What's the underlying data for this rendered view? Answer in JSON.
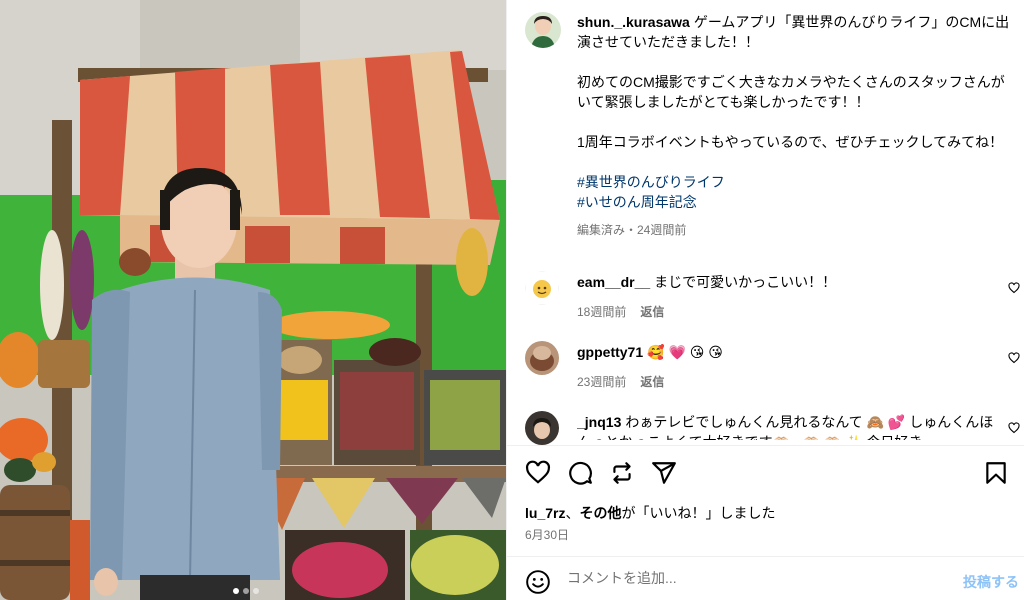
{
  "post": {
    "username": "shun._.kurasawa",
    "caption_lines": [
      "ゲームアプリ「異世界のんびりライフ」のCMに出演させていただきました！！",
      "初めてのCM撮影ですごく大きなカメラやたくさんのスタッフさんがいて緊張しましたがとても楽しかったです！！",
      "1周年コラボイベントもやっているので、ぜひチェックしてみてね！"
    ],
    "hashtags": [
      "#異世界のんびりライフ",
      "#いせのん周年記念"
    ],
    "meta": "編集済み・24週間前"
  },
  "comments": [
    {
      "username": "eam__dr__",
      "text": "まじで可愛いかっこいい！！",
      "time": "18週間前",
      "reply": "返信"
    },
    {
      "username": "gppetty71",
      "text": "🥰 💗 😘 😘",
      "time": "23週間前",
      "reply": "返信"
    },
    {
      "username": "_jnq13",
      "text": "わぁテレビでしゅんくん見れるなんて 🙈 💕 しゅんくんほんっとかっこよくて大好きです🫶🏻 · 🫶🏻 🫶🏻 ✨ 今日好き"
    }
  ],
  "likes": {
    "user": "lu_7rz",
    "sep": "、",
    "others": "その他",
    "tail": "が「いいね！」しました"
  },
  "date": "6月30日",
  "add_comment": {
    "placeholder": "コメントを追加...",
    "post": "投稿する"
  },
  "carousel": {
    "total": 3,
    "active": 1
  },
  "colors": {
    "link": "#00376b",
    "meta": "#737373",
    "post_button": "#8ec3f8"
  }
}
